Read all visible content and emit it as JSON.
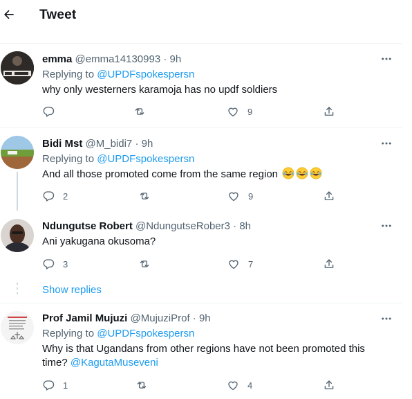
{
  "header": {
    "title": "Tweet"
  },
  "replying_label": "Replying to",
  "show_replies": "Show replies",
  "tweets": [
    {
      "name": "emma",
      "handle": "@emma14130993",
      "time": "9h",
      "reply_to": "@UPDFspokespersn",
      "text": "why only westerners karamoja has no updf soldiers",
      "replies": "",
      "retweets": "",
      "likes": "9"
    },
    {
      "name": "Bidi Mst",
      "handle": "@M_bidi7",
      "time": "9h",
      "reply_to": "@UPDFspokespersn",
      "text": "And all those promoted come from the same region",
      "replies": "2",
      "retweets": "",
      "likes": "9"
    },
    {
      "name": "Ndungutse Robert",
      "handle": "@NdungutseRober3",
      "time": "8h",
      "text": "Ani yakugana okusoma?",
      "replies": "3",
      "retweets": "",
      "likes": "7"
    },
    {
      "name": "Prof Jamil Mujuzi",
      "handle": "@MujuziProf",
      "time": "9h",
      "reply_to": "@UPDFspokespersn",
      "text_line1": "Why is that Ugandans from other regions have  not been promoted this",
      "text_line2": "time?",
      "text_mention": "@KagutaMuseveni",
      "replies": "1",
      "retweets": "",
      "likes": "4"
    }
  ],
  "colors": {
    "link": "#1d9bf0",
    "muted": "#536471",
    "text": "#0f1419",
    "border": "#eff3f4",
    "thread": "#cfd9de"
  }
}
